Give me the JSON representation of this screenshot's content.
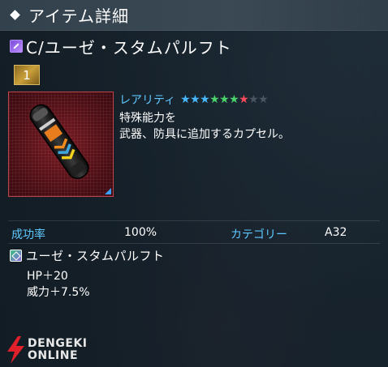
{
  "header": {
    "title": "アイテム詳細"
  },
  "item": {
    "name": "C/ユーゼ・スタムパルフト",
    "count": "1",
    "rarity_label": "レアリティ",
    "rarity": {
      "filled_blue": 3,
      "filled_green": 3,
      "filled_red": 1,
      "empty": 2
    },
    "description_line1": "特殊能力を",
    "description_line2": "武器、防具に追加するカプセル。"
  },
  "stats": {
    "success_label": "成功率",
    "success_value": "100%",
    "category_label": "カテゴリー",
    "category_value": "A32"
  },
  "ability": {
    "name": "ユーゼ・スタムパルフト",
    "effect1": "HP＋20",
    "effect2": "威力＋7.5%"
  },
  "watermark": {
    "line1": "DENGEKI",
    "line2": "ONLINE"
  },
  "colors": {
    "accent": "#5fc8ff",
    "star_blue": "#48b8ff",
    "star_green": "#49d36a",
    "star_red": "#ff4a5a",
    "star_empty": "#4a5560"
  }
}
